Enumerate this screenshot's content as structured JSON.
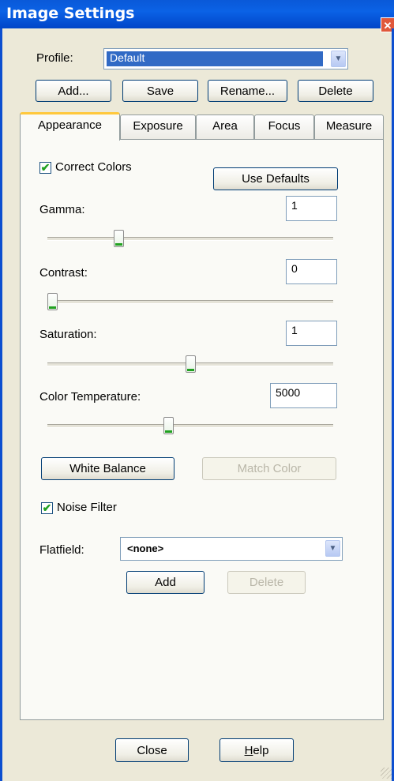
{
  "window": {
    "title": "Image Settings",
    "close_glyph": "✕"
  },
  "profile": {
    "label": "Profile:",
    "value": "Default"
  },
  "profile_buttons": {
    "add": "Add...",
    "save": "Save",
    "rename": "Rename...",
    "delete": "Delete"
  },
  "tabs": [
    "Appearance",
    "Exposure",
    "Area",
    "Focus",
    "Measure"
  ],
  "active_tab": "Appearance",
  "appearance": {
    "correct_colors": {
      "label": "Correct Colors",
      "checked": true
    },
    "use_defaults": "Use Defaults",
    "gamma": {
      "label": "Gamma:",
      "value": "1",
      "slider_fraction": 0.24
    },
    "contrast": {
      "label": "Contrast:",
      "value": "0",
      "slider_fraction": 0.0
    },
    "saturation": {
      "label": "Saturation:",
      "value": "1",
      "slider_fraction": 0.5
    },
    "color_temperature": {
      "label": "Color Temperature:",
      "value": "5000",
      "slider_fraction": 0.42
    },
    "white_balance": "White Balance",
    "match_color": "Match Color",
    "noise_filter": {
      "label": "Noise Filter",
      "checked": true
    },
    "flatfield": {
      "label": "Flatfield:",
      "value": "<none>"
    },
    "flatfield_add": "Add",
    "flatfield_delete": "Delete"
  },
  "footer": {
    "close": "Close",
    "help": "Help"
  },
  "colors": {
    "titlebar": "#0b62e6",
    "check": "#21a121",
    "active_tab_accent": "#ffc83c"
  },
  "icons": {
    "check": "✔",
    "dropdown": "▼"
  }
}
